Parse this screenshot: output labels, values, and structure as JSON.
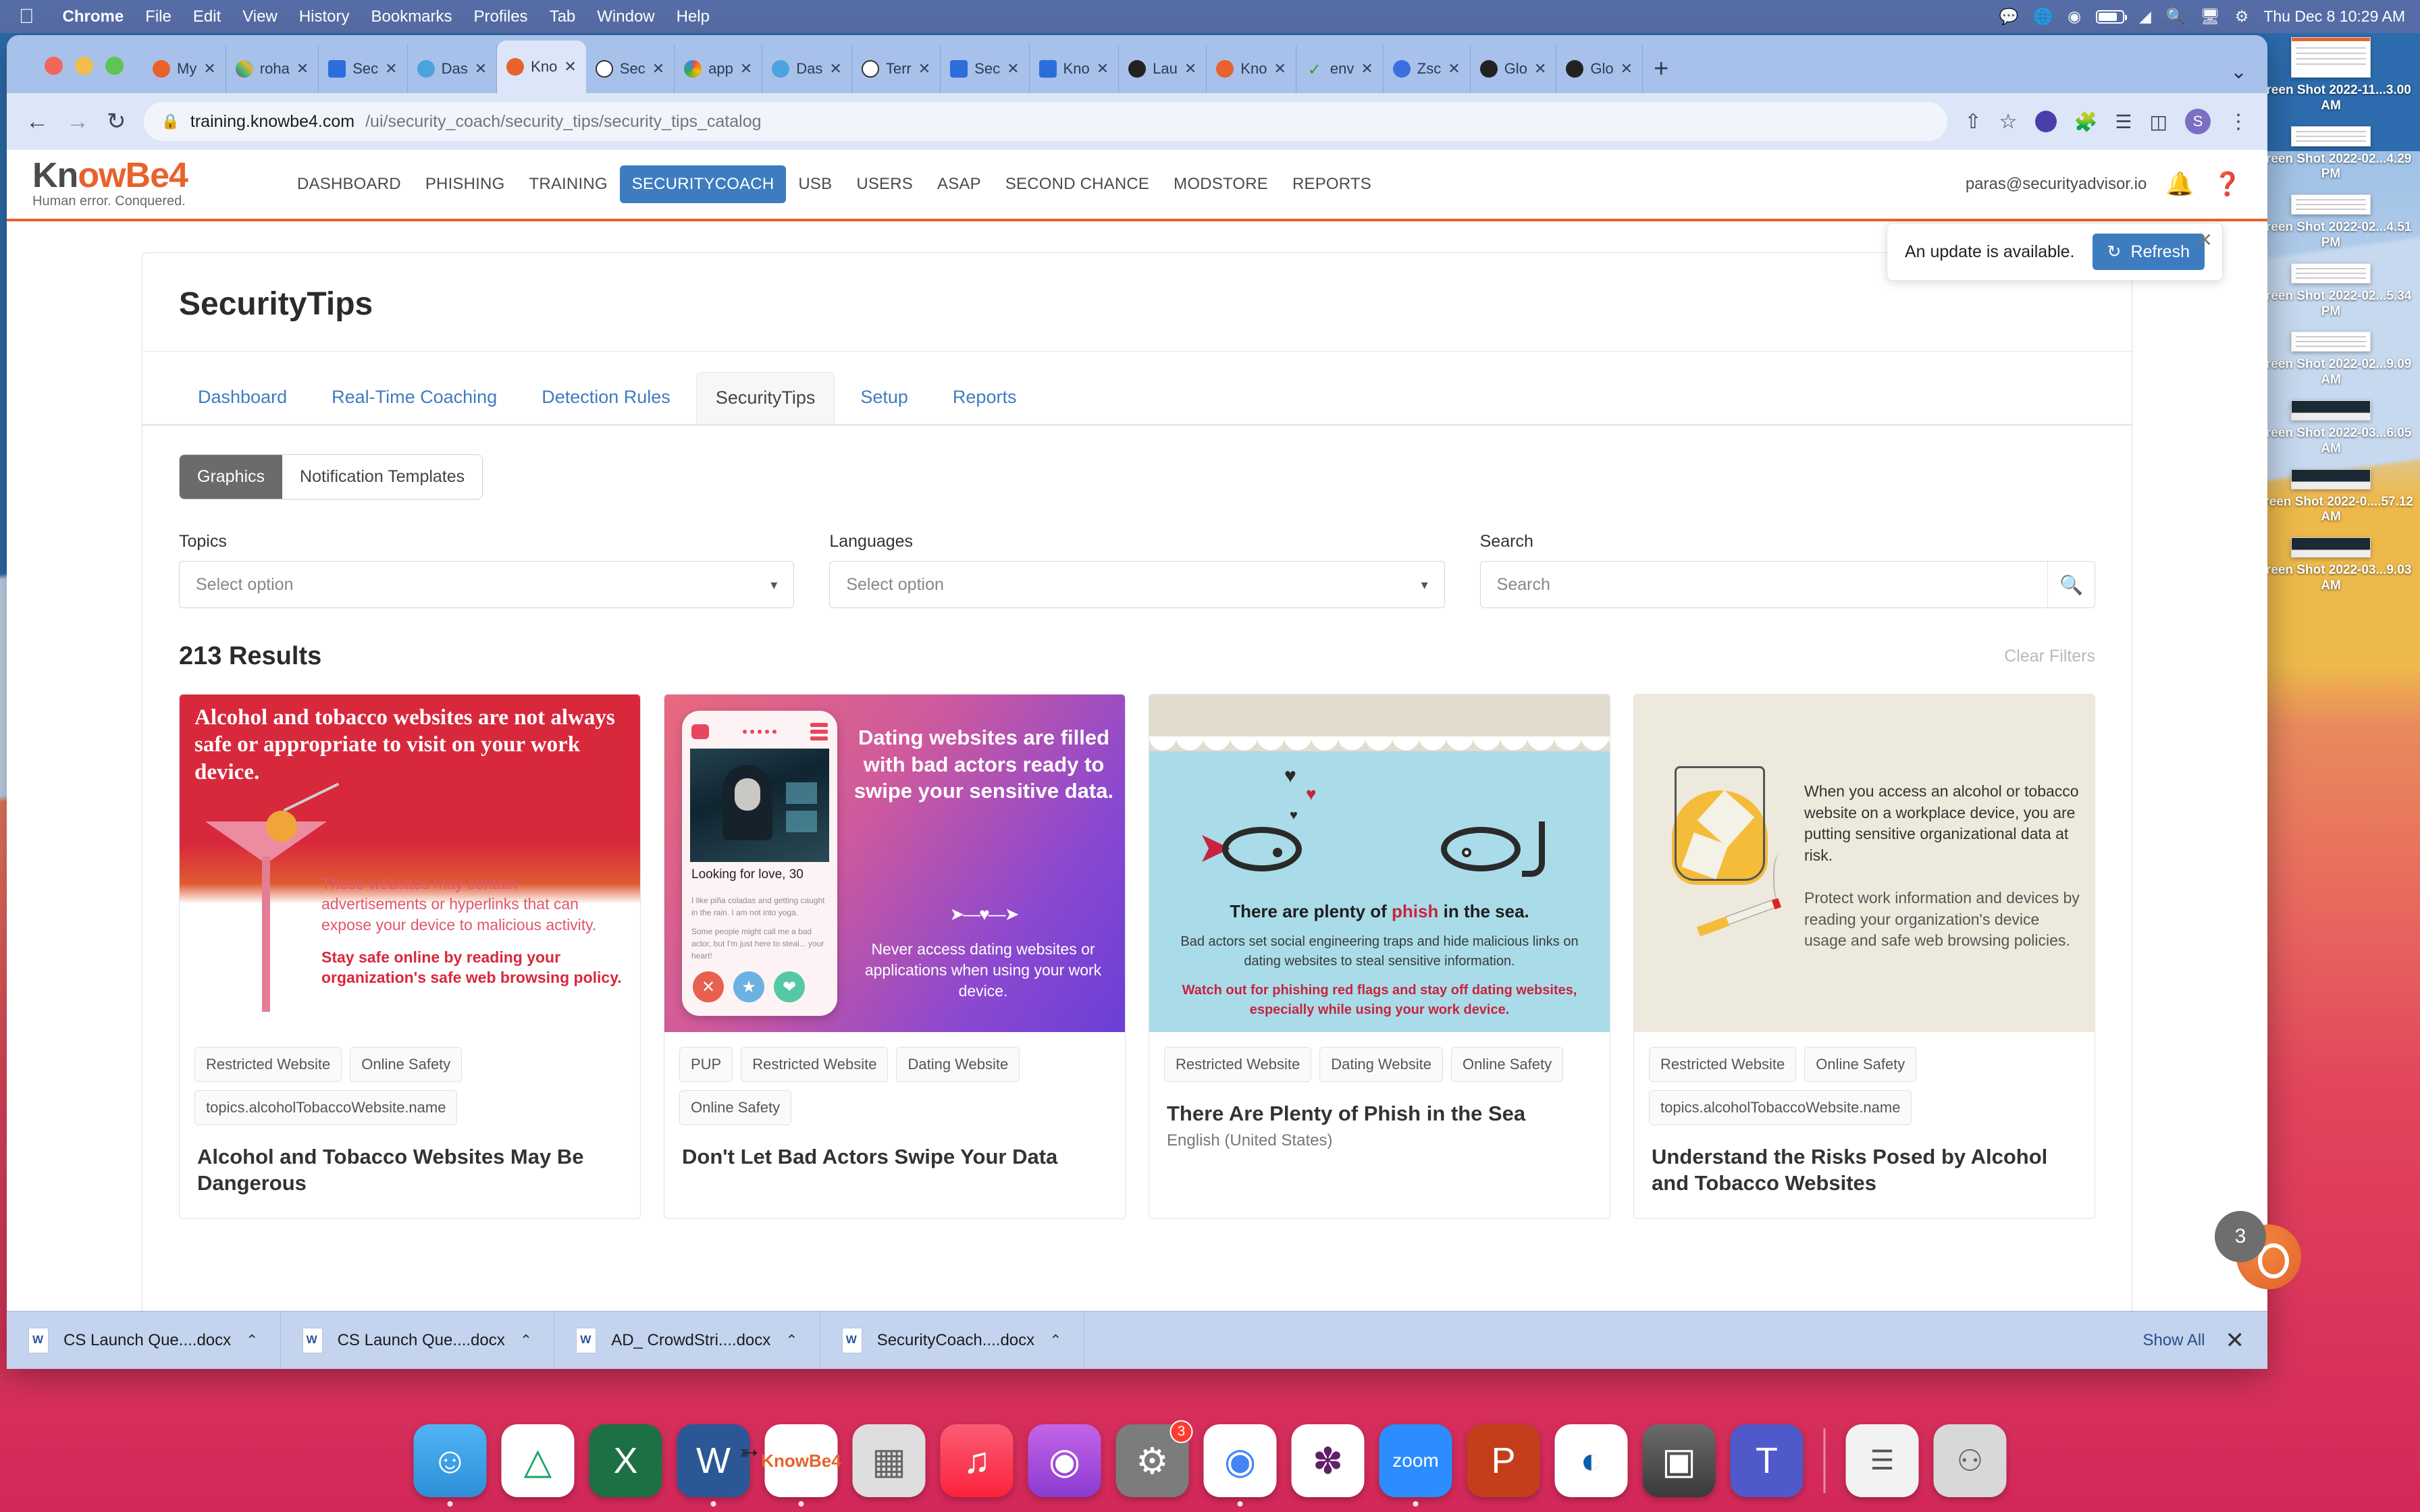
{
  "menubar": {
    "apple_icon": "apple-icon",
    "items": [
      "Chrome",
      "File",
      "Edit",
      "View",
      "History",
      "Bookmarks",
      "Profiles",
      "Tab",
      "Window",
      "Help"
    ],
    "status_icons": [
      "chat-icon",
      "globe-icon",
      "record-icon",
      "battery-icon",
      "wifi-icon",
      "search-icon",
      "screen-share-icon",
      "control-center-icon"
    ],
    "clock": "Thu Dec 8  10:29 AM"
  },
  "browser": {
    "traffic_lights": [
      "close-button",
      "minimize-button",
      "maximize-button"
    ],
    "tabs": [
      {
        "label": "My ",
        "favicon": "knowbe4-icon",
        "active": false
      },
      {
        "label": "roha",
        "favicon": "slack-icon",
        "active": false
      },
      {
        "label": "Sec",
        "favicon": "google-sheets-icon",
        "active": false
      },
      {
        "label": "Das",
        "favicon": "cloud-icon",
        "active": false
      },
      {
        "label": "Kno",
        "favicon": "knowbe4-icon",
        "active": true
      },
      {
        "label": "Sec",
        "favicon": "circle-icon",
        "active": false
      },
      {
        "label": "app",
        "favicon": "google-icon",
        "active": false
      },
      {
        "label": "Das",
        "favicon": "cloud-icon",
        "active": false
      },
      {
        "label": "Terr",
        "favicon": "circle-icon",
        "active": false
      },
      {
        "label": "Sec",
        "favicon": "google-sheets-icon",
        "active": false
      },
      {
        "label": "Kno",
        "favicon": "google-sheets-icon",
        "active": false
      },
      {
        "label": "Lau",
        "favicon": "dark-globe-icon",
        "active": false
      },
      {
        "label": "Kno",
        "favicon": "knowbe4-icon",
        "active": false
      },
      {
        "label": "env",
        "favicon": "check-icon",
        "active": false
      },
      {
        "label": "Zsc",
        "favicon": "zscaler-icon",
        "active": false
      },
      {
        "label": "Glo",
        "favicon": "dark-globe-icon",
        "active": false
      },
      {
        "label": "Glo",
        "favicon": "dark-globe-icon",
        "active": false
      }
    ],
    "tab_close_glyph": "✕",
    "new_tab_label": "+",
    "tab_list_label": "⌄",
    "nav": {
      "back": "←",
      "forward": "→",
      "reload": "↻"
    },
    "omnibox": {
      "lock_icon": "lock-icon",
      "host": "training.knowbe4.com",
      "path": "/ui/security_coach/security_tips/security_tips_catalog"
    },
    "toolbar_right": {
      "share_icon": "share-icon",
      "bookmark_icon": "star-icon",
      "extension_purple": "extension-icon",
      "extension_puzzle": "puzzle-icon",
      "reading_list": "reading-list-icon",
      "side_panel": "side-panel-icon",
      "profile_initial": "S",
      "menu_icon": "kebab-menu-icon"
    }
  },
  "site": {
    "logo": {
      "line1_pre": "Kn",
      "line1_o": "o",
      "line1_post": "wBe4",
      "tagline": "Human error. Conquered."
    },
    "nav": [
      "DASHBOARD",
      "PHISHING",
      "TRAINING",
      "SECURITYCOACH",
      "USB",
      "USERS",
      "ASAP",
      "SECOND CHANCE",
      "MODSTORE",
      "REPORTS"
    ],
    "active_nav": "SECURITYCOACH",
    "user_email": "paras@securityadvisor.io",
    "user_caret": "▾",
    "bell_icon": "bell-icon",
    "help_icon": "help-icon",
    "help_caret": "▾"
  },
  "toast": {
    "message": "An update is available.",
    "refresh_label": "Refresh",
    "refresh_icon": "↻",
    "close_icon": "✕"
  },
  "main": {
    "page_title": "SecurityTips",
    "tabs": [
      {
        "label": "Dashboard",
        "active": false
      },
      {
        "label": "Real-Time Coaching",
        "active": false
      },
      {
        "label": "Detection Rules",
        "active": false
      },
      {
        "label": "SecurityTips",
        "active": true
      },
      {
        "label": "Setup",
        "active": false
      },
      {
        "label": "Reports",
        "active": false
      }
    ],
    "segmented": [
      {
        "label": "Graphics",
        "active": true
      },
      {
        "label": "Notification Templates",
        "active": false
      }
    ],
    "filters": {
      "topics_label": "Topics",
      "topics_value": "Select option",
      "languages_label": "Languages",
      "languages_value": "Select option",
      "search_label": "Search",
      "search_placeholder": "Search",
      "search_value": "",
      "search_icon": "search-icon",
      "caret": "▾"
    },
    "results_count": "213 Results",
    "clear_filters": "Clear Filters",
    "cards": [
      {
        "tags": [
          "Restricted Website",
          "Online Safety",
          "topics.alcoholTobaccoWebsite.name"
        ],
        "title": "Alcohol and Tobacco Websites May Be Dangerous",
        "language": "",
        "art": {
          "headline": "Alcohol and tobacco websites are not always safe or appropriate to visit on your work device.",
          "body": "These websites may contain advertisements or hyperlinks that can expose your device to malicious activity.",
          "body_bold": "Stay safe online by reading your organization's safe web browsing policy.",
          "bg_color": "#d8283c"
        }
      },
      {
        "tags": [
          "PUP",
          "Restricted Website",
          "Dating Website",
          "Online Safety"
        ],
        "title": "Don't Let Bad Actors Swipe Your Data",
        "language": "",
        "art": {
          "headline": "Dating websites are filled with bad actors ready to swipe your sensitive data.",
          "subtext": "Never access dating websites or applications when using your work device.",
          "profile_name": "Looking for love,",
          "profile_age": "30",
          "bio1": "I like piña coladas and getting caught in the rain. I am not into yoga.",
          "bio2": "Some people might call me a bad actor, but I'm just here to steal... your heart!",
          "bg_color": "#8b48d0"
        }
      },
      {
        "tags": [
          "Restricted Website",
          "Dating Website",
          "Online Safety"
        ],
        "title": "There Are Plenty of Phish in the Sea",
        "language": "English (United States)",
        "art": {
          "headline_pre": "There are plenty of ",
          "headline_hl": "phish",
          "headline_post": " in the sea.",
          "body": "Bad actors set social engineering traps and hide malicious links on dating websites to steal sensitive information.",
          "body_red": "Watch out for phishing red flags and stay off dating websites, especially while using your work device.",
          "bg_color": "#a9dce8"
        }
      },
      {
        "tags": [
          "Restricted Website",
          "Online Safety",
          "topics.alcoholTobaccoWebsite.name"
        ],
        "title": "Understand the Risks Posed by Alcohol and Tobacco Websites",
        "language": "",
        "art": {
          "body1": "When you access an alcohol or tobacco website on a workplace device, you are putting sensitive organizational data at risk.",
          "body2": "Protect work information and devices by reading your organization's device usage and safe web browsing policies.",
          "bg_color": "#edeadd"
        }
      }
    ]
  },
  "downloads": {
    "items": [
      {
        "name": "CS Launch Que....docx",
        "caret": "⌃"
      },
      {
        "name": "CS Launch Que....docx",
        "caret": "⌃"
      },
      {
        "name": "AD_ CrowdStri....docx",
        "caret": "⌃"
      },
      {
        "name": "SecurityCoach....docx",
        "caret": "⌃"
      }
    ],
    "show_all": "Show All",
    "close_icon": "✕"
  },
  "desktop_files": [
    {
      "label": "Screen Shot 2022-11...3.00 AM",
      "thumb": "light"
    },
    {
      "label": "Screen Shot 2022-02...4.29 PM",
      "thumb": "wide"
    },
    {
      "label": "Screen Shot 2022-02...4.51 PM",
      "thumb": "wide"
    },
    {
      "label": "Screen Shot 2022-02...5.34 PM",
      "thumb": "wide"
    },
    {
      "label": "Screen Shot 2022-02...9.09 AM",
      "thumb": "wide"
    },
    {
      "label": "Screen Shot 2022-03...6.05 AM",
      "thumb": "dark"
    },
    {
      "label": "Screen Shot 2022-0....57.12 AM",
      "thumb": "dark"
    },
    {
      "label": "Screen Shot 2022-03...9.03 AM",
      "thumb": "dark"
    }
  ],
  "float_badge": {
    "count": "3"
  },
  "dock": {
    "items": [
      {
        "name": "finder-icon",
        "glyph": "☺",
        "color": "#3fa7f0",
        "running": true
      },
      {
        "name": "google-drive-icon",
        "glyph": "▲",
        "color": "#ffffff",
        "running": false
      },
      {
        "name": "excel-icon",
        "glyph": "X",
        "color": "#1d7044",
        "running": false
      },
      {
        "name": "word-icon",
        "glyph": "W",
        "color": "#2b5797",
        "running": true
      },
      {
        "name": "knowbe4-icon",
        "glyph": "",
        "color": "#ffffff",
        "running": true
      },
      {
        "name": "launchpad-icon",
        "glyph": "∷",
        "color": "#dedede",
        "running": false
      },
      {
        "name": "music-icon",
        "glyph": "♫",
        "color": "#fc3c44",
        "running": false
      },
      {
        "name": "podcasts-icon",
        "glyph": "◉",
        "color": "#9a53d8",
        "running": false
      },
      {
        "name": "system-settings-icon",
        "glyph": "⚙",
        "color": "#7c7c7c",
        "running": false,
        "badge": "3"
      },
      {
        "name": "chrome-icon",
        "glyph": "●",
        "color": "#ffffff",
        "running": true
      },
      {
        "name": "slack-icon",
        "glyph": "✽",
        "color": "#ffffff",
        "running": false
      },
      {
        "name": "zoom-icon",
        "glyph": "zoom",
        "color": "#2d8cff",
        "running": true
      },
      {
        "name": "powerpoint-icon",
        "glyph": "P",
        "color": "#c43e1c",
        "running": false
      },
      {
        "name": "webex-icon",
        "glyph": "◐",
        "color": "#ffffff",
        "running": false
      },
      {
        "name": "preview-icon",
        "glyph": "▣",
        "color": "#4a4a4a",
        "running": false
      },
      {
        "name": "teams-icon",
        "glyph": "T",
        "color": "#5059c9",
        "running": false
      },
      {
        "name": "documents-stack-icon",
        "glyph": "☰",
        "color": "#e8e8e8",
        "running": false
      },
      {
        "name": "trash-icon",
        "glyph": "Ὕ1",
        "color": "#d8d8d8",
        "running": false
      }
    ]
  }
}
